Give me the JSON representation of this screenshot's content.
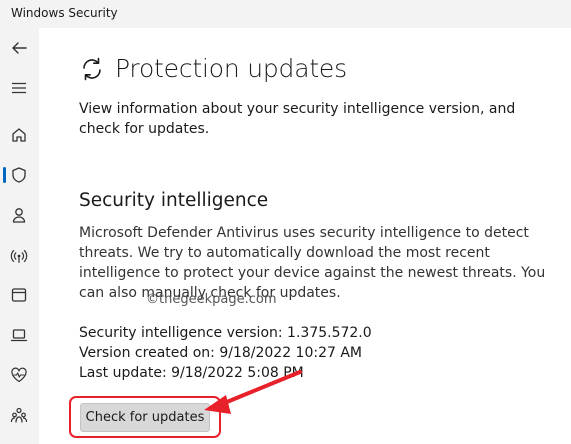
{
  "window": {
    "title": "Windows Security"
  },
  "sidebar": {
    "items": [
      {
        "icon": "back-arrow-icon"
      },
      {
        "icon": "hamburger-menu-icon"
      },
      {
        "icon": "home-icon"
      },
      {
        "icon": "shield-icon",
        "active": true
      },
      {
        "icon": "person-icon"
      },
      {
        "icon": "wireless-icon"
      },
      {
        "icon": "browser-window-icon"
      },
      {
        "icon": "laptop-icon"
      },
      {
        "icon": "heart-pulse-icon"
      },
      {
        "icon": "family-icon"
      }
    ]
  },
  "main": {
    "title": "Protection updates",
    "title_icon": "refresh-icon",
    "description": "View information about your security intelligence version, and check for updates.",
    "section": {
      "title": "Security intelligence",
      "description": "Microsoft Defender Antivirus uses security intelligence to detect threats. We try to automatically download the most recent intelligence to protect your device against the newest threats. You can also manually check for updates.",
      "watermark": "©thegeekpage.com",
      "version_line": "Security intelligence version: 1.375.572.0",
      "created_line": "Version created on: 9/18/2022 10:27 AM",
      "last_update_line": "Last update: 9/18/2022 5:08 PM",
      "button_label": "Check for updates"
    }
  },
  "colors": {
    "accent": "#0067c0",
    "annotation": "#e8202a",
    "sidebar_bg": "#f3f3f3"
  }
}
